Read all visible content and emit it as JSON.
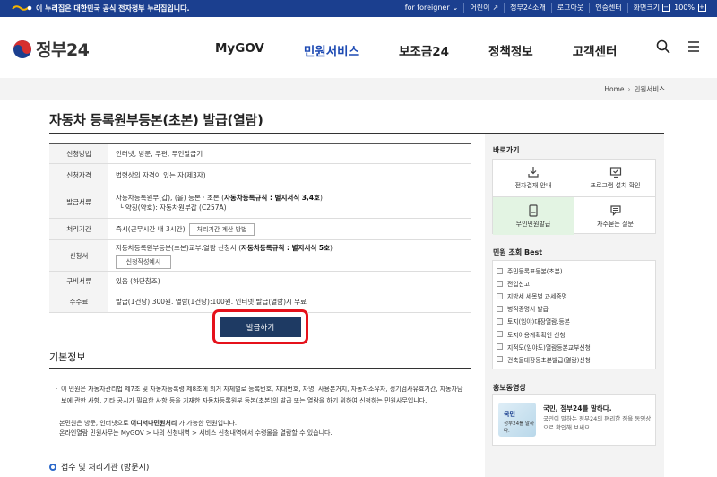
{
  "topbar": {
    "gov_notice": "이 누리집은 대한민국 공식 전자정부 누리집입니다.",
    "links": [
      "for foreigner",
      "어린이",
      "정부24소개",
      "로그아웃",
      "인증센터",
      "화면크기"
    ],
    "zoom": "100%"
  },
  "header": {
    "logo_text": "정부24",
    "nav": [
      "MyGOV",
      "민원서비스",
      "보조금24",
      "정책정보",
      "고객센터"
    ],
    "active_nav": "민원서비스"
  },
  "breadcrumb": {
    "home": "Home",
    "current": "민원서비스"
  },
  "page_title": "자동차 등록원부등본(초본) 발급(열람)",
  "info": {
    "method_label": "신청방법",
    "method": "인터넷, 방문, 우편, 무인발급기",
    "qual_label": "신청자격",
    "qual": "법령상의 자격이 있는 자(제3자)",
    "doc_label": "발급서류",
    "doc_line1_pre": "자동차등록원부(갑), (을) 등본 · 초본 (",
    "doc_line1_bold": "자동차등록규칙 : 별지서식 3,4호",
    "doc_line1_post": ")",
    "doc_line2": "└ 약칭(약호): 자동차원부갑 (C257A)",
    "period_label": "처리기간",
    "period": "즉시(근무시간 내 3시간)",
    "period_btn": "처리기간 계산 방법",
    "form_label": "신청서",
    "form_pre": "자동차등록원부등본(초본)교부.열람 신청서 (",
    "form_bold": "자동차등록규칙 : 별지서식 5호",
    "form_post": ")",
    "form_btn": "신청작성예시",
    "attach_label": "구비서류",
    "attach": "있음 (하단참조)",
    "fee_label": "수수료",
    "fee": "발급(1건당):300원. 열람(1건당):100원. 인터넷 발급(열람)시 무료"
  },
  "issue_button": "발급하기",
  "basic_info": {
    "title": "기본정보",
    "desc_bullet": "·",
    "desc": "이 민원은 자동차관리법 제7조 및 자동차등록령 제8조에 의거 자체별로 등록번호, 차대번호, 차명, 사용본거지, 자동차소유자, 정기검사유효기간, 자동차담보에 관한 사항, 기타 공시가 필요한 사항 등을 기재한 자동차등록원부 등본(초본)의 발급 또는 열람을 하기 위하여 신청하는 민원사무입니다.",
    "desc2_pre": "본민원은 방문, 인터넷으로 ",
    "desc2_bold": "어디서나민원처리",
    "desc2_post": " 가 가능한 민원입니다.",
    "desc3": "온라인열람 민원사무는 MyGOV > 나의 신청내역 > 서비스 신청내역에서 수령물을 열람할 수 있습니다.",
    "receipt": "접수 및 처리기관 (방문시)"
  },
  "sidebar": {
    "shortcut_title": "바로가기",
    "shortcuts": [
      "전자결재 안내",
      "프로그램 설치 확인",
      "무인민원발급",
      "자주묻는 질문"
    ],
    "best_title": "민원 조회 Best",
    "best": [
      "주민등록표등본(초본)",
      "전입신고",
      "지방세 세목별 과세증명",
      "병적증명서 발급",
      "토지(임야)대장열람.등본",
      "토지이용계획확인 신청",
      "지적도(임야도)열람등본교부신청",
      "건축물대장등초본발급(열람)신청"
    ],
    "promo_title": "홍보동영상",
    "promo_heading": "국민, 정부24를 말하다.",
    "promo_desc": "국민이 말하는 정부24의 편리한 점을 동영상으로 확인해 보세요.",
    "promo_thumb_1": "국민",
    "promo_thumb_2": "정부24를 말하다."
  }
}
